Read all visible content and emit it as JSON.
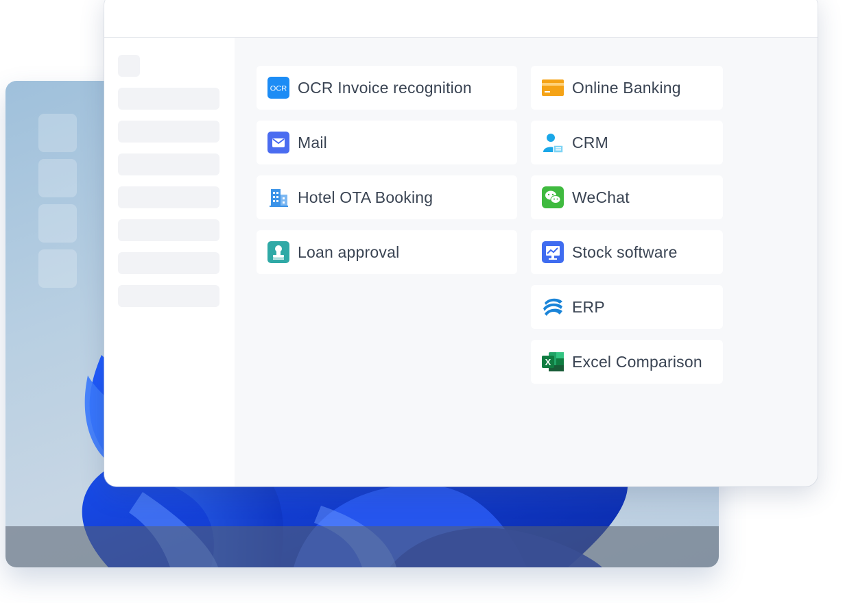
{
  "apps_left": [
    {
      "label": "OCR Invoice recognition",
      "icon": "ocr-icon",
      "icon_text": "OCR"
    },
    {
      "label": "Mail",
      "icon": "mail-icon"
    },
    {
      "label": "Hotel OTA Booking",
      "icon": "hotel-building-icon"
    },
    {
      "label": "Loan approval",
      "icon": "stamp-icon"
    }
  ],
  "apps_right": [
    {
      "label": "Online Banking",
      "icon": "bank-card-icon"
    },
    {
      "label": "CRM",
      "icon": "person-card-icon"
    },
    {
      "label": "WeChat",
      "icon": "wechat-icon"
    },
    {
      "label": "Stock software",
      "icon": "stock-chart-icon"
    },
    {
      "label": "ERP",
      "icon": "erp-globe-icon"
    },
    {
      "label": "Excel Comparison",
      "icon": "excel-icon",
      "icon_text": "X"
    }
  ],
  "colors": {
    "ocr": "#1c8cf5",
    "mail": "#4a6cf0",
    "hotel": "#3b93e8",
    "loan": "#2fa9a6",
    "bank": "#f5a316",
    "crm": "#1aa7e8",
    "wechat": "#3fba3f",
    "stock": "#3f6cf0",
    "erp": "#1a84d8",
    "excel": "#1f7a45"
  }
}
